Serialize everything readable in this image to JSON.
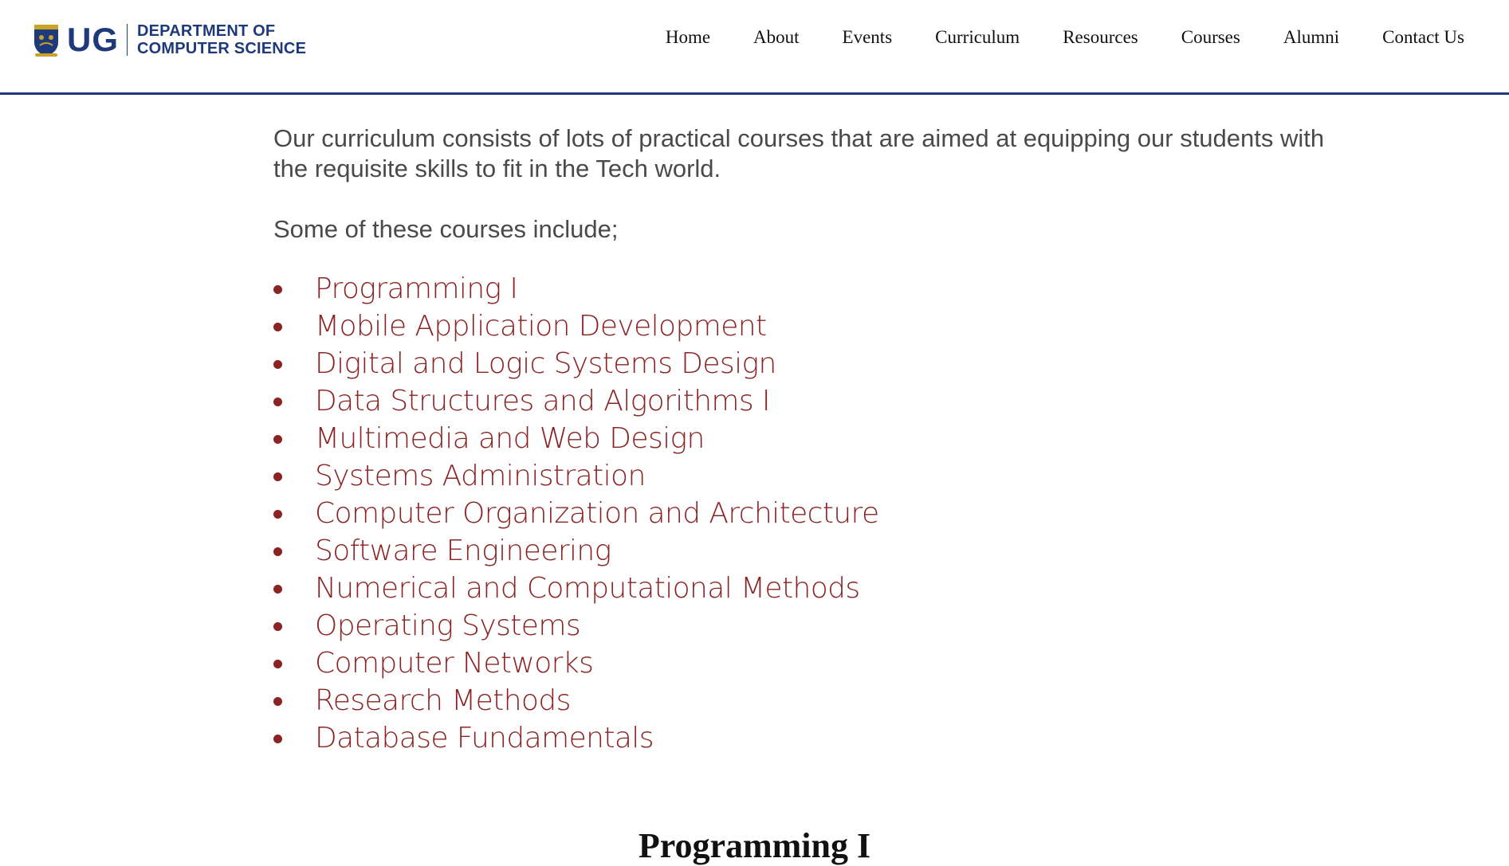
{
  "header": {
    "logo": {
      "ug": "UG",
      "dept_line1": "DEPARTMENT OF",
      "dept_line2": "COMPUTER SCIENCE"
    },
    "nav": [
      {
        "label": "Home"
      },
      {
        "label": "About"
      },
      {
        "label": "Events"
      },
      {
        "label": "Curriculum"
      },
      {
        "label": "Resources"
      },
      {
        "label": "Courses"
      },
      {
        "label": "Alumni"
      },
      {
        "label": "Contact Us"
      }
    ]
  },
  "main": {
    "intro": "Our curriculum consists of lots of practical courses that are aimed at equipping our students with the requisite skills to fit in the Tech world.",
    "lead": "Some of these courses include;",
    "courses": [
      "Programming I",
      "Mobile Application Development",
      "Digital and Logic Systems Design",
      "Data Structures and Algorithms I",
      "Multimedia and Web Design",
      "Systems Administration",
      "Computer Organization and Architecture",
      "Software Engineering",
      "Numerical and Computational Methods",
      "Operating Systems",
      "Computer Networks",
      "Research Methods",
      "Database Fundamentals"
    ],
    "section_heading": "Programming I"
  },
  "colors": {
    "brand_blue": "#1f3a7a",
    "course_red": "#8b2323",
    "body_gray": "#4a4a4a"
  }
}
